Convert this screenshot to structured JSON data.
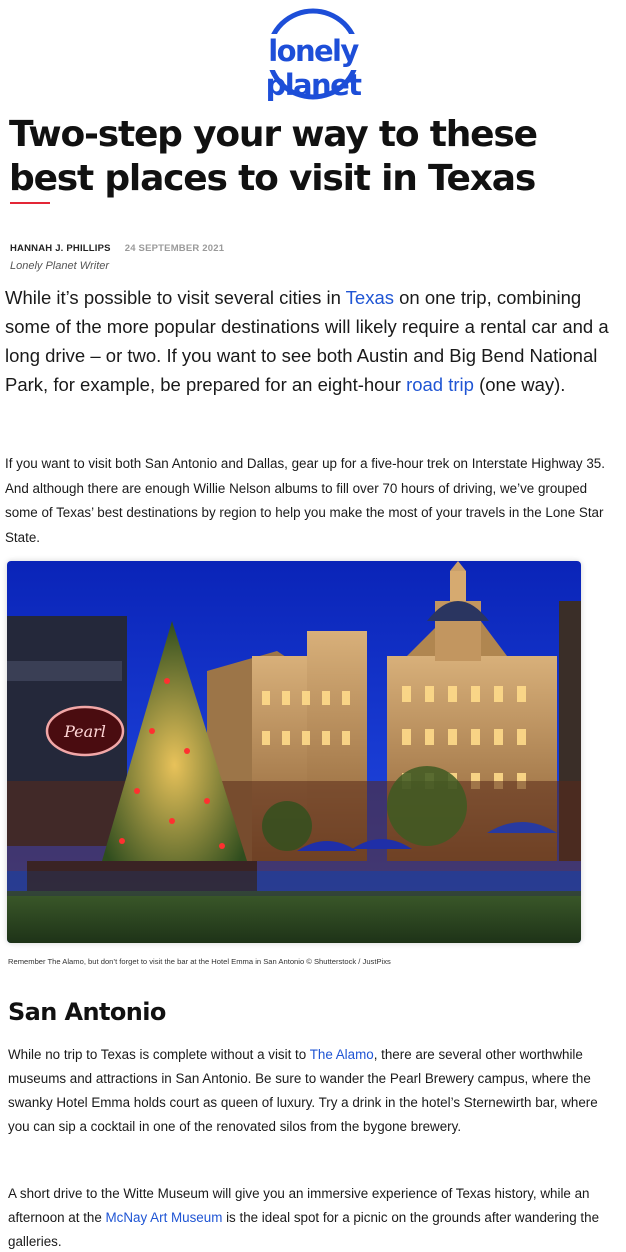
{
  "brand": {
    "logo_text": "lonely planet",
    "accent": "#1d4ed8",
    "rule_color": "#e32636"
  },
  "article": {
    "title": "Two-step your way to these best places to visit in Texas",
    "author": "HANNAH J. PHILLIPS",
    "date": "24 SEPTEMBER 2021",
    "author_role": "Lonely Planet Writer",
    "lead": {
      "t1": "While it’s possible to visit several cities in ",
      "link1": "Texas",
      "t2": " on one trip, combining some of the more popular destinations will likely require a rental car and a long drive – or two. If you want to see both Austin and Big Bend National Park, for example, be prepared for an eight-hour ",
      "link2": "road trip",
      "t3": " (one way)."
    },
    "para1": "If you want to visit both San Antonio and Dallas, gear up for a five-hour trek on Interstate Highway 35. And although there are enough Willie Nelson albums to fill over 70 hours of driving, we’ve grouped some of Texas’ best destinations by region to help you make the most of your travels in the Lone Star State.",
    "image": {
      "sign_text": "Pearl",
      "caption": "Remember The Alamo, but don’t forget to visit the bar at the Hotel Emma in San Antonio © Shutterstock / JustPixs"
    },
    "section_heading": "San Antonio",
    "para2": {
      "t1": "While no trip to Texas is complete without a visit to ",
      "link1": "The Alamo",
      "t2": ", there are several other worthwhile museums and attractions in San Antonio. Be sure to wander the Pearl Brewery campus, where the swanky Hotel Emma holds court as queen of luxury. Try a drink in the hotel’s Sternewirth bar, where you can sip a cocktail in one of the renovated silos from the bygone brewery."
    },
    "para3": {
      "t1": "A short drive to the Witte Museum will give you an immersive experience of Texas history, while an afternoon at the ",
      "link1": "McNay Art Museum",
      "t2": " is the ideal spot for a picnic on the grounds after wandering the galleries."
    }
  }
}
